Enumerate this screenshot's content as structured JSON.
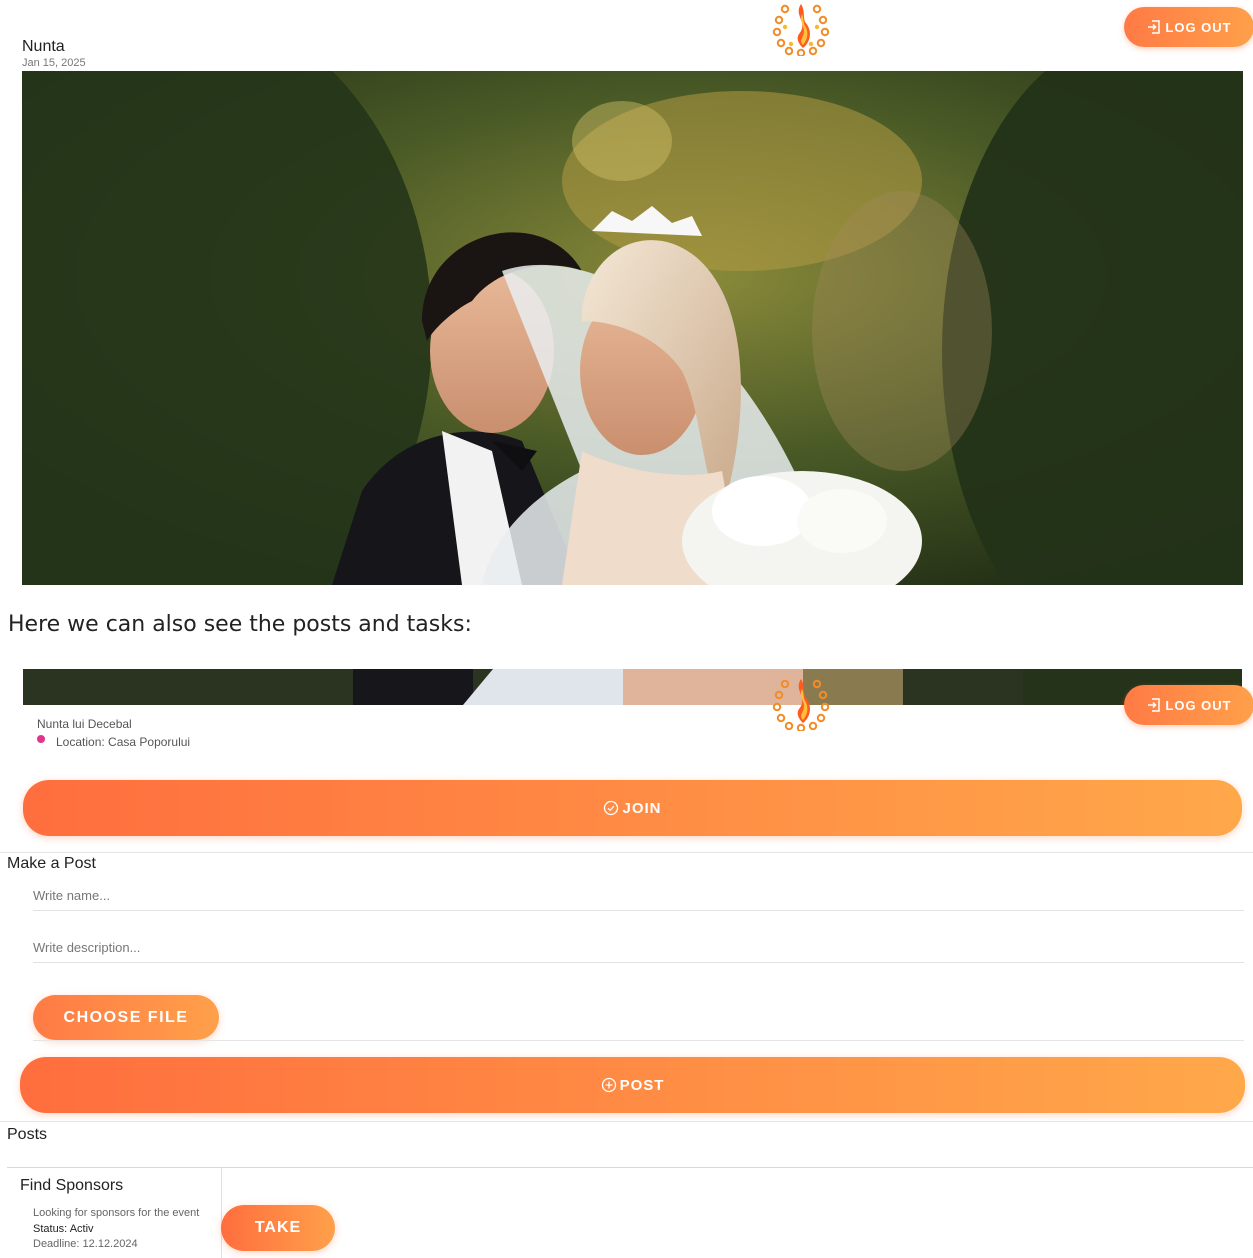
{
  "top_view": {
    "logout_label": "LOG OUT",
    "event_title": "Nunta",
    "event_date": "Jan 15, 2025"
  },
  "caption": "Here we can also see the posts and tasks:",
  "event_view": {
    "logout_label": "LOG OUT",
    "event_name": "Nunta lui Decebal",
    "location": "Location: Casa Poporului",
    "join_label": "JOIN",
    "make_post": {
      "title": "Make a Post",
      "name_placeholder": "Write name...",
      "description_placeholder": "Write description...",
      "choose_file_label": "CHOOSE FILE",
      "post_label": "POST"
    },
    "posts_title": "Posts",
    "tasks": [
      {
        "title": "Find Sponsors",
        "description": "Looking for sponsors for the event",
        "status": "Status: Activ",
        "deadline": "Deadline: 12.12.2024",
        "take_label": "TAKE"
      }
    ]
  },
  "colors": {
    "accent_start": "#ff6e3e",
    "accent_end": "#ffa84a",
    "location_pin": "#e0358a"
  },
  "icons": [
    "flame-logo-icon",
    "logout-icon",
    "check-circle-icon",
    "plus-circle-icon",
    "location-pin-icon"
  ]
}
